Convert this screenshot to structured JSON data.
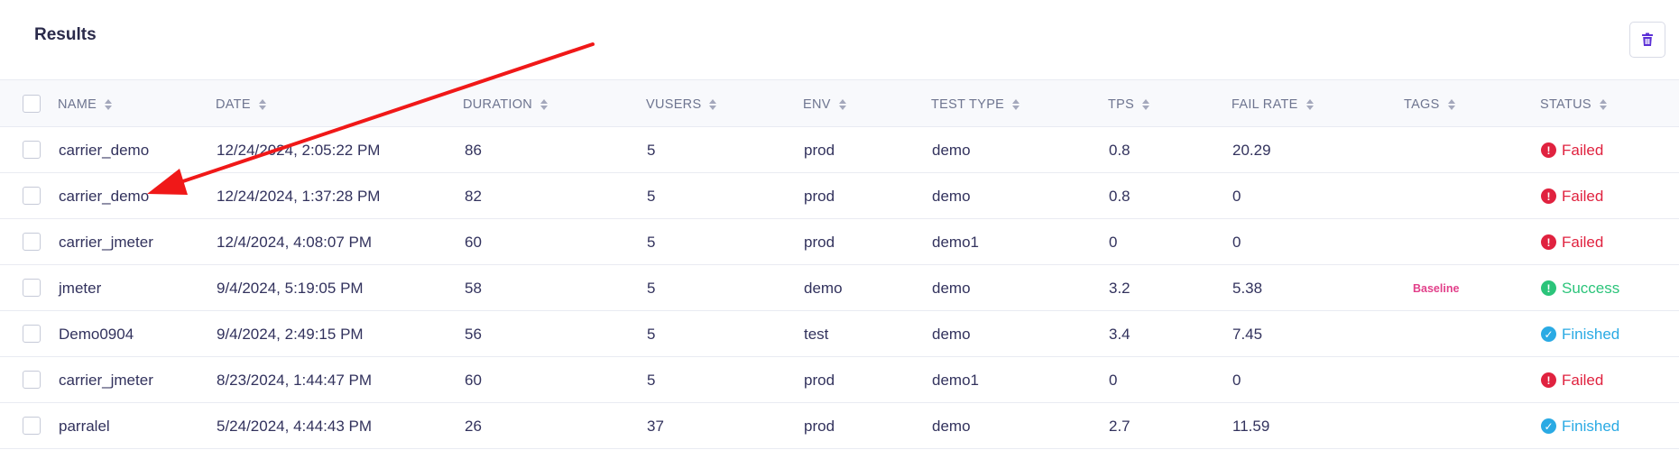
{
  "title": "Results",
  "delete_icon": "trash-icon",
  "columns": [
    {
      "key": "name",
      "label": "NAME"
    },
    {
      "key": "date",
      "label": "DATE"
    },
    {
      "key": "duration",
      "label": "DURATION"
    },
    {
      "key": "vusers",
      "label": "VUSERS"
    },
    {
      "key": "env",
      "label": "ENV"
    },
    {
      "key": "test_type",
      "label": "TEST TYPE"
    },
    {
      "key": "tps",
      "label": "TPS"
    },
    {
      "key": "fail_rate",
      "label": "FAIL RATE"
    },
    {
      "key": "tags",
      "label": "TAGS"
    },
    {
      "key": "status",
      "label": "STATUS"
    }
  ],
  "rows": [
    {
      "name": "carrier_demo",
      "date": "12/24/2024, 2:05:22 PM",
      "duration": "86",
      "vusers": "5",
      "env": "prod",
      "test_type": "demo",
      "tps": "0.8",
      "fail_rate": "20.29",
      "tags": "",
      "status": "Failed",
      "status_kind": "failed"
    },
    {
      "name": "carrier_demo",
      "date": "12/24/2024, 1:37:28 PM",
      "duration": "82",
      "vusers": "5",
      "env": "prod",
      "test_type": "demo",
      "tps": "0.8",
      "fail_rate": "0",
      "tags": "",
      "status": "Failed",
      "status_kind": "failed"
    },
    {
      "name": "carrier_jmeter",
      "date": "12/4/2024, 4:08:07 PM",
      "duration": "60",
      "vusers": "5",
      "env": "prod",
      "test_type": "demo1",
      "tps": "0",
      "fail_rate": "0",
      "tags": "",
      "status": "Failed",
      "status_kind": "failed"
    },
    {
      "name": "jmeter",
      "date": "9/4/2024, 5:19:05 PM",
      "duration": "58",
      "vusers": "5",
      "env": "demo",
      "test_type": "demo",
      "tps": "3.2",
      "fail_rate": "5.38",
      "tags": "Baseline",
      "status": "Success",
      "status_kind": "success"
    },
    {
      "name": "Demo0904",
      "date": "9/4/2024, 2:49:15 PM",
      "duration": "56",
      "vusers": "5",
      "env": "test",
      "test_type": "demo",
      "tps": "3.4",
      "fail_rate": "7.45",
      "tags": "",
      "status": "Finished",
      "status_kind": "finished"
    },
    {
      "name": "carrier_jmeter",
      "date": "8/23/2024, 1:44:47 PM",
      "duration": "60",
      "vusers": "5",
      "env": "prod",
      "test_type": "demo1",
      "tps": "0",
      "fail_rate": "0",
      "tags": "",
      "status": "Failed",
      "status_kind": "failed"
    },
    {
      "name": "parralel",
      "date": "5/24/2024, 4:44:43 PM",
      "duration": "26",
      "vusers": "37",
      "env": "prod",
      "test_type": "demo",
      "tps": "2.7",
      "fail_rate": "11.59",
      "tags": "",
      "status": "Finished",
      "status_kind": "finished"
    }
  ],
  "status_colors": {
    "failed": "#e0223f",
    "success": "#2bc47a",
    "finished": "#2aaae4"
  },
  "status_icons": {
    "failed": "exclamation-circle-icon",
    "success": "exclamation-circle-icon",
    "finished": "check-circle-icon"
  },
  "annotation_color": "#f01818"
}
